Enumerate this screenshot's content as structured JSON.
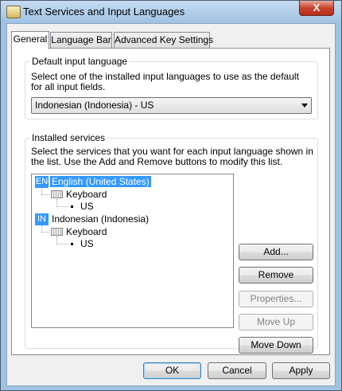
{
  "window": {
    "title": "Text Services and Input Languages",
    "close_label": "X"
  },
  "tabs": [
    {
      "label": "General",
      "active": true
    },
    {
      "label": "Language Bar",
      "active": false
    },
    {
      "label": "Advanced Key Settings",
      "active": false
    }
  ],
  "default_lang": {
    "label": "Default input language",
    "desc": "Select one of the installed input languages to use as the default for all input fields.",
    "selected": "Indonesian (Indonesia) - US"
  },
  "installed": {
    "label": "Installed services",
    "desc": "Select the services that you want for each input language shown in the list. Use the Add and Remove buttons to modify this list.",
    "tree": [
      {
        "badge": "EN",
        "name": "English (United States)",
        "selected": true,
        "category": "Keyboard",
        "service": "US"
      },
      {
        "badge": "IN",
        "name": "Indonesian (Indonesia)",
        "selected": false,
        "category": "Keyboard",
        "service": "US"
      }
    ]
  },
  "buttons": {
    "add": "Add...",
    "remove": "Remove",
    "properties": "Properties...",
    "move_up": "Move Up",
    "move_down": "Move Down"
  },
  "footer": {
    "ok": "OK",
    "cancel": "Cancel",
    "apply": "Apply"
  },
  "colors": {
    "selection": "#3399ff",
    "window_frame": "#9fc3e3",
    "close_button": "#c8432e"
  },
  "icons": {
    "app": "text-services-icon",
    "keyboard": "keyboard-icon"
  }
}
